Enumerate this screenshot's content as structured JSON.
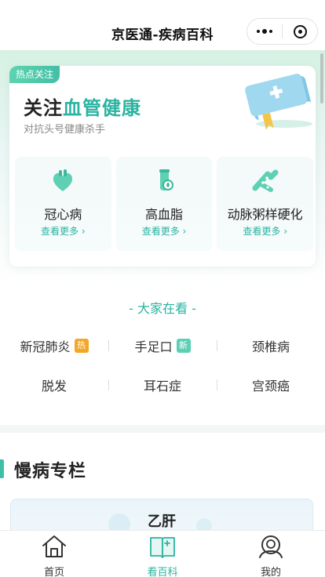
{
  "navbar": {
    "title": "京医通-疾病百科"
  },
  "hero": {
    "badge": "热点关注",
    "title_prefix": "关注",
    "title_highlight": "血管健康",
    "subtitle": "对抗头号健康杀手",
    "diseases": [
      {
        "name": "冠心病",
        "more": "查看更多",
        "icon": "heart-icon"
      },
      {
        "name": "高血脂",
        "more": "查看更多",
        "icon": "test-tube-icon"
      },
      {
        "name": "动脉粥样硬化",
        "more": "查看更多",
        "icon": "artery-icon"
      }
    ]
  },
  "watching": {
    "title": "- 大家在看 -",
    "tags": [
      {
        "label": "新冠肺炎",
        "badge": "热",
        "badge_type": "hot"
      },
      {
        "label": "手足口",
        "badge": "新",
        "badge_type": "new"
      },
      {
        "label": "颈椎病",
        "badge": ""
      },
      {
        "label": "脱发",
        "badge": ""
      },
      {
        "label": "耳石症",
        "badge": ""
      },
      {
        "label": "宫颈癌",
        "badge": ""
      }
    ]
  },
  "chronic": {
    "title": "慢病专栏",
    "first_card": "乙肝"
  },
  "tabbar": {
    "items": [
      {
        "label": "首页",
        "icon": "home-icon",
        "active": false
      },
      {
        "label": "看百科",
        "icon": "book-icon",
        "active": true
      },
      {
        "label": "我的",
        "icon": "user-icon",
        "active": false
      }
    ]
  },
  "colors": {
    "accent": "#2bb3a0",
    "hot": "#f5a623",
    "new": "#5ccfb4"
  }
}
